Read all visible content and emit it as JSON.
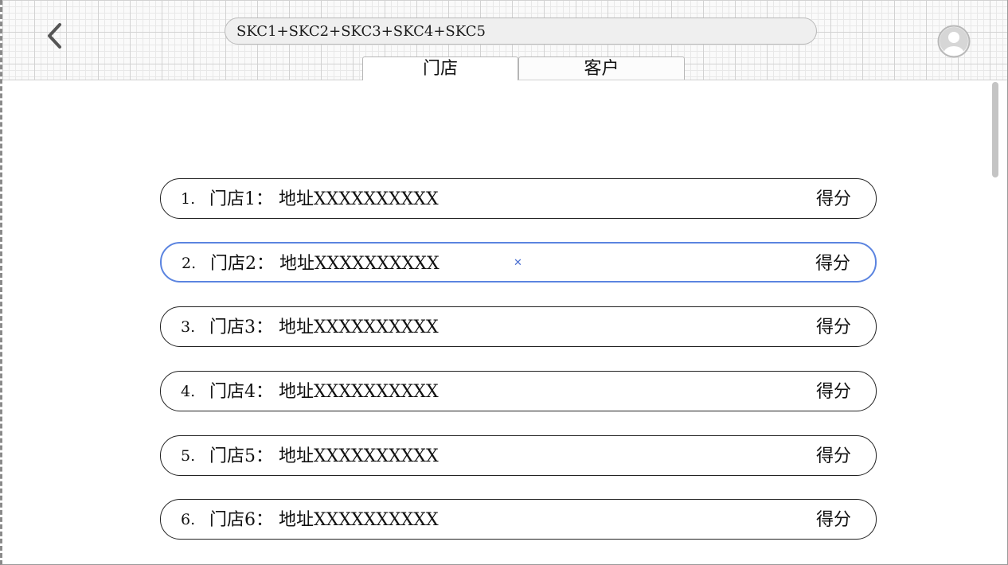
{
  "header": {
    "back_icon": "chevron-left-icon",
    "search_value": "SKC1+SKC2+SKC3+SKC4+SKC5",
    "avatar_icon": "user-avatar-icon"
  },
  "tabs": [
    {
      "label": "门店",
      "active": true
    },
    {
      "label": "客户",
      "active": false
    }
  ],
  "stores": [
    {
      "index": "1.",
      "name": "门店1：  地址XXXXXXXXXX",
      "score": "得分"
    },
    {
      "index": "2.",
      "name": "门店2：  地址XXXXXXXXXX",
      "score": "得分"
    },
    {
      "index": "3.",
      "name": "门店3：  地址XXXXXXXXXX",
      "score": "得分"
    },
    {
      "index": "4.",
      "name": "门店4：  地址XXXXXXXXXX",
      "score": "得分"
    },
    {
      "index": "5.",
      "name": "门店5：  地址XXXXXXXXXX",
      "score": "得分"
    },
    {
      "index": "6.",
      "name": "门店6：  地址XXXXXXXXXX",
      "score": "得分"
    }
  ],
  "colors": {
    "selected_border": "#5b84e0",
    "row_border": "#222222",
    "grid": "#d2d2d2"
  }
}
